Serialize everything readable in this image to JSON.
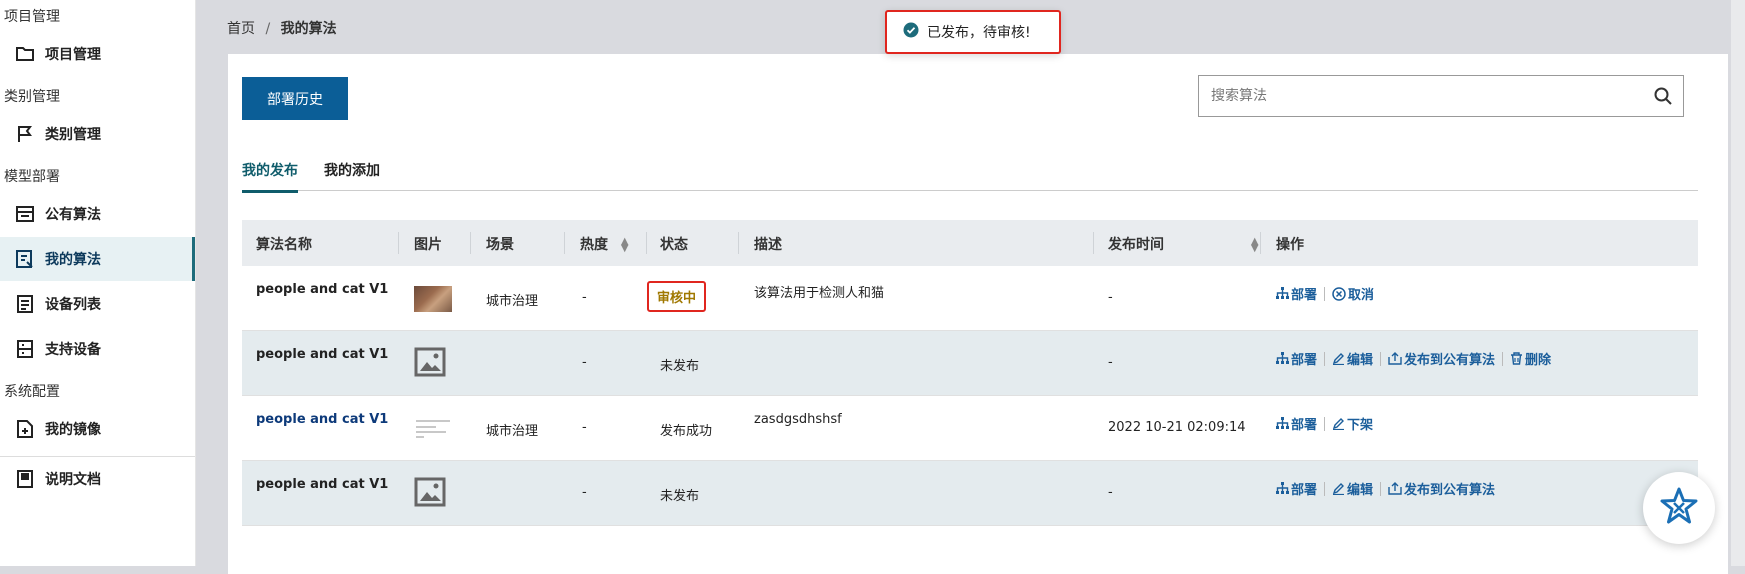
{
  "sidebar": {
    "groups": [
      "项目管理",
      "类别管理",
      "模型部署",
      "系统配置"
    ],
    "items": [
      {
        "label": "项目管理",
        "icon": "folder-icon"
      },
      {
        "label": "类别管理",
        "icon": "flag-icon"
      },
      {
        "label": "公有算法",
        "icon": "store-icon"
      },
      {
        "label": "我的算法",
        "icon": "algorithm-icon"
      },
      {
        "label": "设备列表",
        "icon": "device-list-icon"
      },
      {
        "label": "支持设备",
        "icon": "supported-device-icon"
      },
      {
        "label": "我的镜像",
        "icon": "image-file-icon"
      },
      {
        "label": "说明文档",
        "icon": "book-icon"
      }
    ]
  },
  "breadcrumb": {
    "home": "首页",
    "separator": "/",
    "current": "我的算法"
  },
  "toast": {
    "message": "已发布，待审核!"
  },
  "toolbar": {
    "deploy_history": "部署历史",
    "search_placeholder": "搜索算法"
  },
  "tabs": [
    {
      "label": "我的发布",
      "active": true
    },
    {
      "label": "我的添加",
      "active": false
    }
  ],
  "table": {
    "columns": [
      "算法名称",
      "图片",
      "场景",
      "热度",
      "状态",
      "描述",
      "发布时间",
      "操作"
    ],
    "rows": [
      {
        "name": "people and cat V1",
        "image": "photo",
        "scene": "城市治理",
        "heat": "-",
        "status": "审核中",
        "desc": "该算法用于检测人和猫",
        "time": "-",
        "ops": [
          "部署",
          "取消"
        ]
      },
      {
        "name": "people and cat V1",
        "image": "placeholder",
        "scene": "",
        "heat": "-",
        "status": "未发布",
        "desc": "",
        "time": "-",
        "ops": [
          "部署",
          "编辑",
          "发布到公有算法",
          "删除"
        ]
      },
      {
        "name": "people and cat V1",
        "image": "document",
        "scene": "城市治理",
        "heat": "-",
        "status": "发布成功",
        "desc": "zasdgsdhshsf",
        "time": "2022 10-21 02:09:14",
        "ops": [
          "部署",
          "下架"
        ]
      },
      {
        "name": "people and cat V1",
        "image": "placeholder",
        "scene": "",
        "heat": "-",
        "status": "未发布",
        "desc": "",
        "time": "-",
        "ops": [
          "部署",
          "编辑",
          "发布到公有算法"
        ]
      }
    ]
  },
  "colors": {
    "primary": "#0b5e97",
    "accent": "#0f5c6b",
    "link": "#1b5e9b",
    "warning": "#a07800",
    "highlight_border": "#e0261f"
  }
}
